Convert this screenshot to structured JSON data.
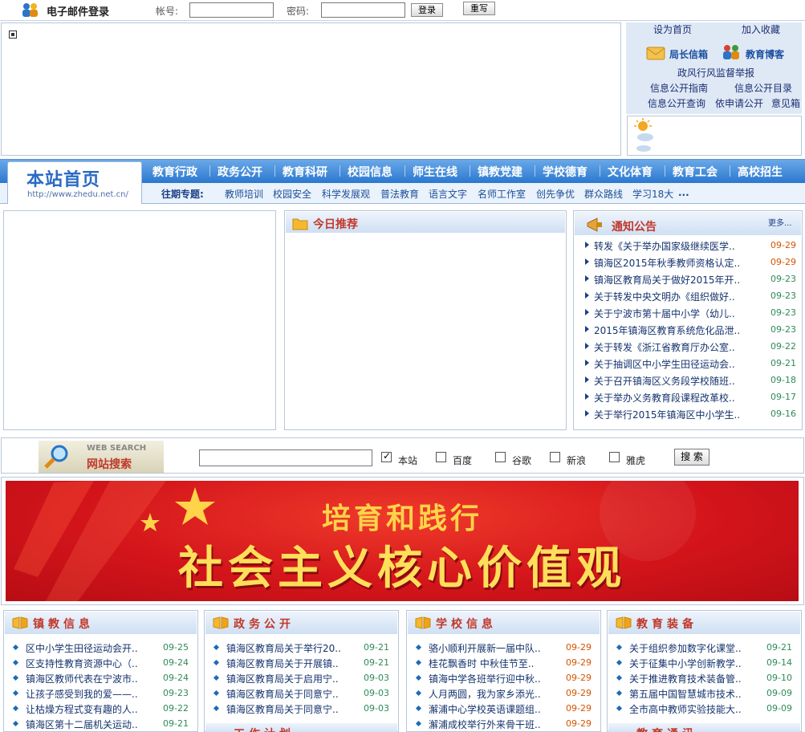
{
  "email_bar": {
    "title": "电子邮件登录",
    "account_label": "帐号:",
    "password_label": "密码:",
    "login_label": "登录",
    "reset_label": "重写"
  },
  "quick_links": {
    "set_home": "设为首页",
    "add_favorite": "加入收藏",
    "director_mailbox": "局长信箱",
    "edu_blog": "教育博客",
    "supervision": "政风行风监督举报",
    "disclosure_guide": "信息公开指南",
    "disclosure_catalog": "信息公开目录",
    "disclosure_query": "信息公开查询",
    "apply_disclosure": "依申请公开",
    "feedback": "意见箱"
  },
  "nav": {
    "home_title": "本站首页",
    "home_url": "http://www.zhedu.net.cn/",
    "items": [
      "教育行政",
      "政务公开",
      "教育科研",
      "校园信息",
      "师生在线",
      "镇教党建",
      "学校德育",
      "文化体育",
      "教育工会",
      "高校招生"
    ],
    "topics_label": "往期专题:",
    "topics": [
      "教师培训",
      "校园安全",
      "科学发展观",
      "普法教育",
      "语言文字",
      "名师工作室",
      "创先争优",
      "群众路线",
      "学习18大"
    ],
    "topics_more": "..."
  },
  "today": {
    "title": "今日推荐"
  },
  "notice": {
    "title": "通知公告",
    "more": "更多...",
    "items": [
      {
        "title": "转发《关于举办国家级继续医学..",
        "date": "09-29"
      },
      {
        "title": "镇海区2015年秋季教师资格认定..",
        "date": "09-29"
      },
      {
        "title": "镇海区教育局关于做好2015年开..",
        "date": "09-23"
      },
      {
        "title": "关于转发中央文明办《组织做好..",
        "date": "09-23"
      },
      {
        "title": "关于宁波市第十届中小学（幼儿..",
        "date": "09-23"
      },
      {
        "title": "2015年镇海区教育系统危化品泄..",
        "date": "09-23"
      },
      {
        "title": "关于转发《浙江省教育厅办公室..",
        "date": "09-22"
      },
      {
        "title": "关于抽调区中小学生田径运动会..",
        "date": "09-21"
      },
      {
        "title": "关于召开镇海区义务段学校随班..",
        "date": "09-18"
      },
      {
        "title": "关于举办义务教育段课程改革校..",
        "date": "09-17"
      },
      {
        "title": "关于举行2015年镇海区中小学生..",
        "date": "09-16"
      }
    ]
  },
  "search": {
    "logo_en": "WEB SEARCH",
    "logo_cn": "网站搜索",
    "options": [
      {
        "label": "本站",
        "checked": true
      },
      {
        "label": "百度",
        "checked": false
      },
      {
        "label": "谷歌",
        "checked": false
      },
      {
        "label": "新浪",
        "checked": false
      },
      {
        "label": "雅虎",
        "checked": false
      }
    ],
    "button": "搜 索"
  },
  "banner": {
    "line1": "培育和践行",
    "line2": "社会主义核心价值观"
  },
  "columns": [
    {
      "title": "镇教信息",
      "items": [
        {
          "title": "区中小学生田径运动会开..",
          "date": "09-25"
        },
        {
          "title": "区支持性教育资源中心（..",
          "date": "09-24"
        },
        {
          "title": "镇海区教师代表在宁波市..",
          "date": "09-24"
        },
        {
          "title": "让孩子感受到我的爱——..",
          "date": "09-23"
        },
        {
          "title": "让枯燥方程式变有趣的人..",
          "date": "09-22"
        },
        {
          "title": "镇海区第十二届机关运动..",
          "date": "09-21"
        }
      ]
    },
    {
      "title": "政务公开",
      "items": [
        {
          "title": "镇海区教育局关于举行20..",
          "date": "09-21"
        },
        {
          "title": "镇海区教育局关于开展镇..",
          "date": "09-21"
        },
        {
          "title": "镇海区教育局关于启用宁..",
          "date": "09-03"
        },
        {
          "title": "镇海区教育局关于同意宁..",
          "date": "09-03"
        },
        {
          "title": "镇海区教育局关于同意宁..",
          "date": "09-03"
        }
      ],
      "sub_title": "工作计划"
    },
    {
      "title": "学校信息",
      "items": [
        {
          "title": "骆小顺利开展新一届中队..",
          "date": "09-29"
        },
        {
          "title": "桂花飘香时 中秋佳节至..",
          "date": "09-29"
        },
        {
          "title": "镇海中学各班举行迎中秋..",
          "date": "09-29"
        },
        {
          "title": "人月两圆，我为家乡添光..",
          "date": "09-29"
        },
        {
          "title": "澥浦中心学校英语课题组..",
          "date": "09-29"
        },
        {
          "title": "澥浦成校举行外来骨干班..",
          "date": "09-29"
        }
      ]
    },
    {
      "title": "教育装备",
      "items": [
        {
          "title": "关于组织参加数字化课堂..",
          "date": "09-21"
        },
        {
          "title": "关于征集中小学创新教学..",
          "date": "09-14"
        },
        {
          "title": "关于推进教育技术装备管..",
          "date": "09-10"
        },
        {
          "title": "第五届中国智慧城市技术..",
          "date": "09-09"
        },
        {
          "title": "全市高中教师实验技能大..",
          "date": "09-09"
        }
      ],
      "sub_title": "教育通讯"
    }
  ],
  "colors": {
    "nav_blue": "#2b78cf",
    "date_orange": "#d35400",
    "date_green": "#2e8b57",
    "title_red": "#c0392b",
    "banner_red": "#d4151b"
  }
}
